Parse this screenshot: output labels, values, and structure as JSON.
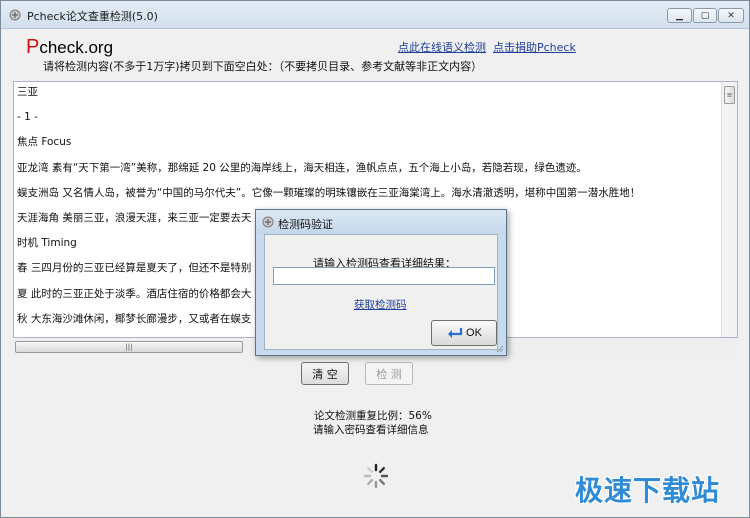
{
  "window": {
    "title": "Pcheck论文查重检测(5.0)",
    "min_label": "▁",
    "max_label": "▢",
    "close_label": "✕"
  },
  "header": {
    "logo_p": "P",
    "logo_rest": "check.org",
    "link_semantic": "点此在线语义检测",
    "link_donate": "点击捐助Pcheck",
    "instruction": "请将检测内容(不多于1万字)拷贝到下面空白处：（不要拷贝目录、参考文献等非正文内容）"
  },
  "content": {
    "lines": [
      "三亚",
      "- 1 -",
      "焦点 Focus",
      "亚龙湾 素有“天下第一湾”美称，那绵延 20 公里的海岸线上，海天相连，渔帆点点，五个海上小岛，若隐若现，绿色遗迹。",
      "蜈支洲岛 又名情人岛，被誉为“中国的马尔代夫”。它像一颗璀璨的明珠镶嵌在三亚海棠湾上。海水清澈透明，堪称中国第一潜水胜地！",
      "天涯海角 美丽三亚，浪漫天涯，来三亚一定要去天                                                              白沙、巨石浑然一体。",
      "时机 Timing",
      "春 三四月份的三亚已经算是夏天了，但还不是特别                                                              。",
      "夏 此时的三亚正处于淡季。酒店住宿的价格都会大                                                              做好防晒措施！",
      "秋 大东海沙滩休闲，椰梦长廊漫步，又或者在蜈支                                                              一座岛的感觉！"
    ]
  },
  "scroll": {
    "grip": "≡",
    "hgrip": "|||"
  },
  "buttons": {
    "clear": "清 空",
    "check": "检 测"
  },
  "result": {
    "ratio_label": "论文检测重复比例：56%",
    "hint": "请输入密码查看详细信息"
  },
  "dialog": {
    "title": "检测码验证",
    "prompt": "请输入检测码查看详细结果：",
    "input_value": "",
    "get_code_link": "获取检测码",
    "ok_label": "OK"
  },
  "watermark": "极速下载站",
  "colors": {
    "logo_red": "#d01010",
    "link_blue": "#1d3f9a",
    "watermark_blue": "#2f8bd6"
  }
}
